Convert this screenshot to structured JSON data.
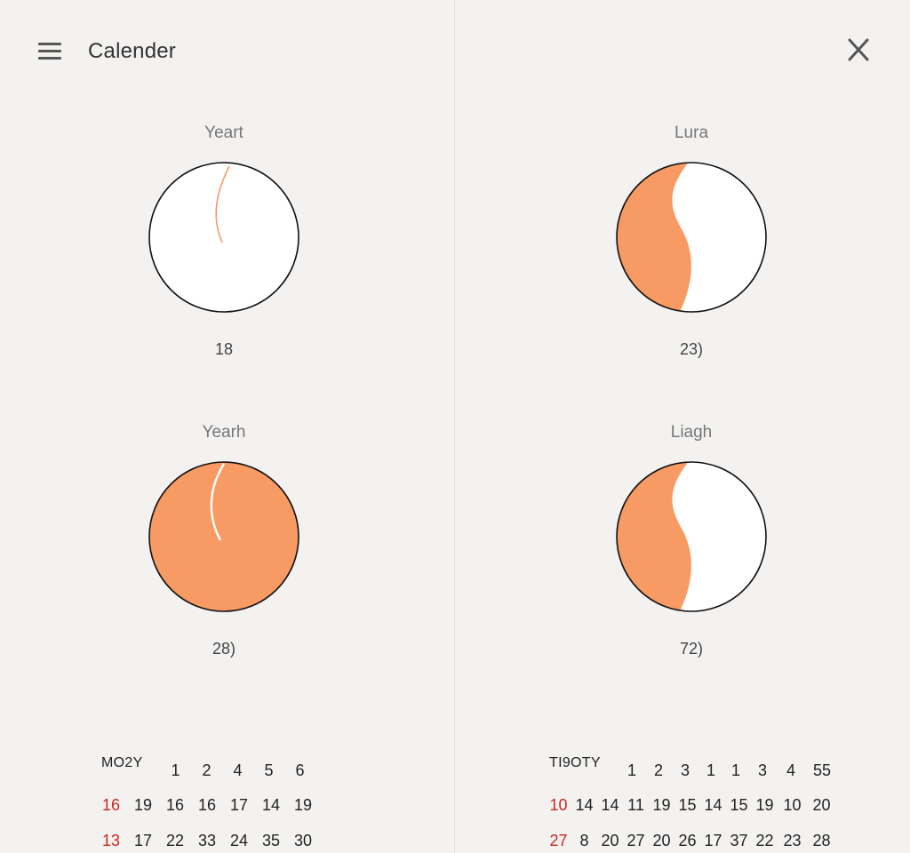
{
  "app": {
    "title": "Calender"
  },
  "icons": {
    "menu": "hamburger-menu-icon",
    "close": "close-x-icon"
  },
  "colors": {
    "accent": "#f79a64",
    "stroke": "#111111",
    "holiday": "#c8281e",
    "background": "#f3f2f1"
  },
  "cards": [
    {
      "title": "Yeart",
      "value": "18",
      "fill": "thin-arc"
    },
    {
      "title": "Lura",
      "value": "23)",
      "fill": "left-half"
    },
    {
      "title": "Yearh",
      "value": "28)",
      "fill": "full"
    },
    {
      "title": "Liagh",
      "value": "72)",
      "fill": "left-half"
    }
  ],
  "calendars": [
    {
      "label": "MO2Y",
      "rows": [
        [
          "1",
          "2",
          "4",
          "5",
          "6"
        ],
        [
          "16",
          "19",
          "16",
          "16",
          "17",
          "14",
          "19"
        ],
        [
          "13",
          "17",
          "22",
          "33",
          "24",
          "35",
          "30"
        ]
      ]
    },
    {
      "label": "TI9OTY",
      "rows": [
        [
          "1",
          "2",
          "3",
          "1",
          "1",
          "3",
          "4",
          "55"
        ],
        [
          "10",
          "14",
          "14",
          "11",
          "19",
          "15",
          "14",
          "15",
          "19",
          "10",
          "20"
        ],
        [
          "27",
          "8",
          "20",
          "27",
          "20",
          "26",
          "17",
          "37",
          "22",
          "23",
          "28"
        ]
      ]
    }
  ]
}
